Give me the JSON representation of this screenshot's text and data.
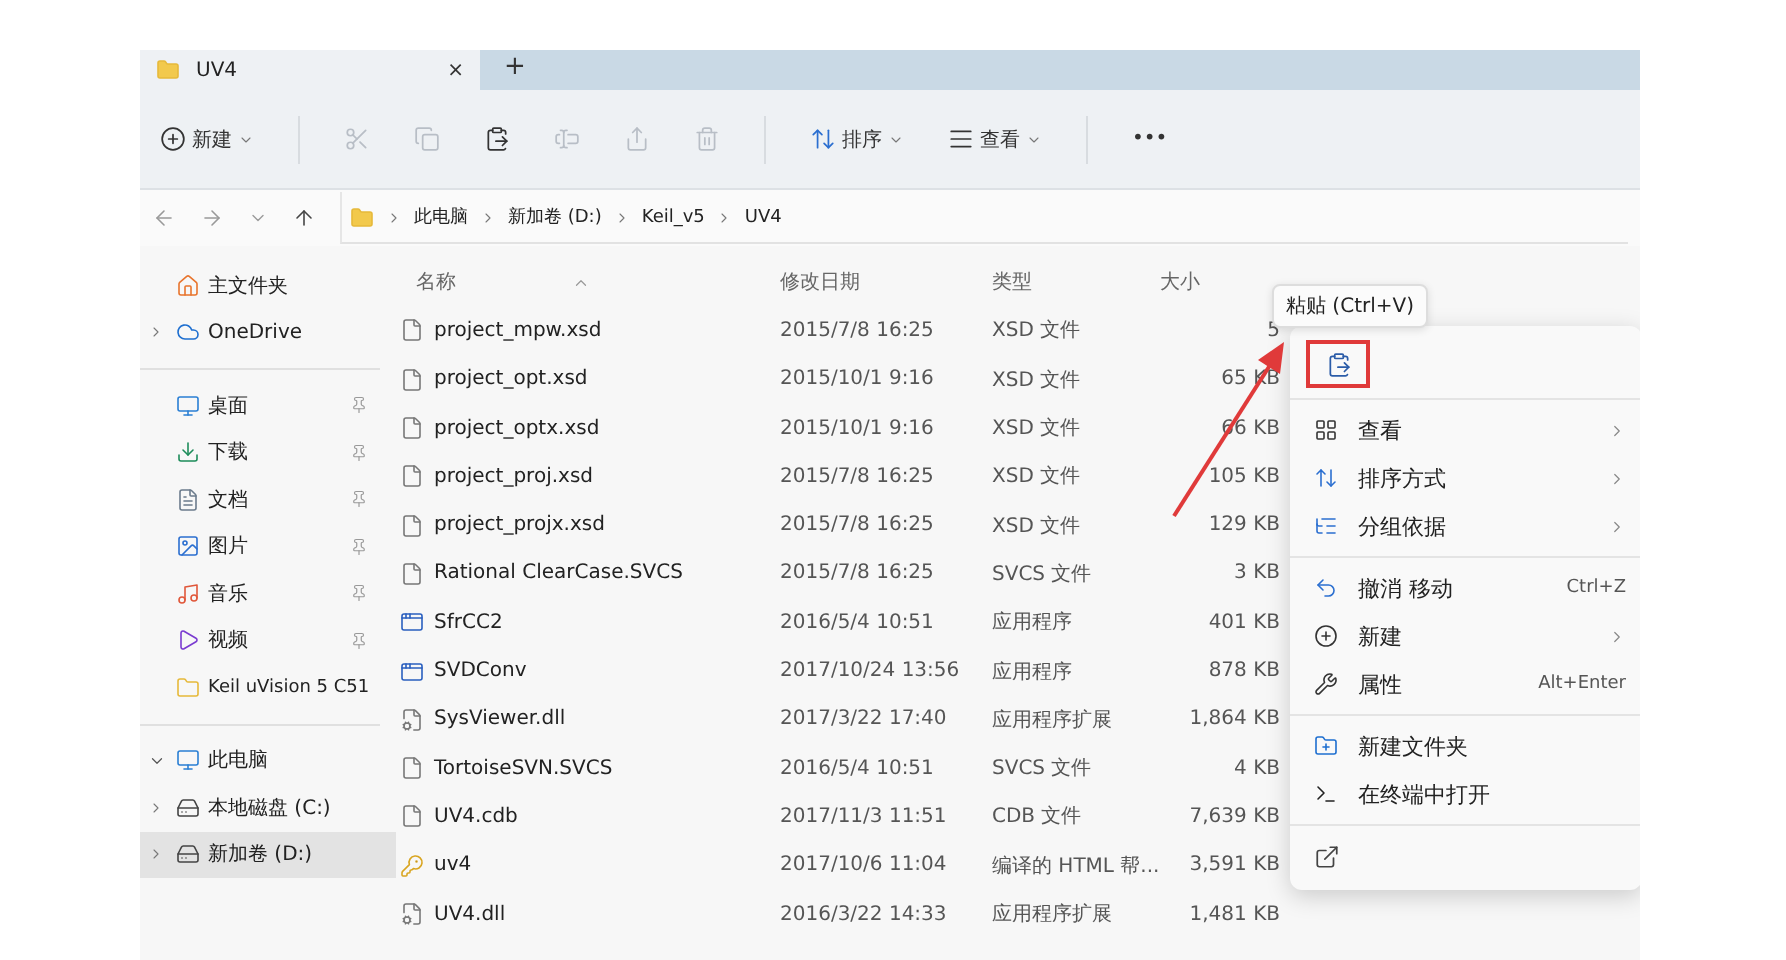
{
  "tab": {
    "title": "UV4",
    "close": "×",
    "new_tab": "+"
  },
  "toolbar": [
    {
      "kind": "new",
      "label": "新建",
      "dropdown": true,
      "disabled": false
    },
    {
      "kind": "cut",
      "disabled": true
    },
    {
      "kind": "copy",
      "disabled": true
    },
    {
      "kind": "paste",
      "disabled": false
    },
    {
      "kind": "rename",
      "disabled": true
    },
    {
      "kind": "share",
      "disabled": true
    },
    {
      "kind": "delete",
      "disabled": true
    },
    {
      "kind": "sort",
      "label": "排序",
      "dropdown": true,
      "disabled": false
    },
    {
      "kind": "view",
      "label": "查看",
      "dropdown": true,
      "disabled": false
    },
    {
      "kind": "more",
      "label": "•••",
      "disabled": false
    }
  ],
  "breadcrumb": [
    "此电脑",
    "新加卷 (D:)",
    "Keil_v5",
    "UV4"
  ],
  "sidebar": [
    [
      {
        "kind": "home",
        "label": "主文件夹",
        "pinned": false,
        "selected": false
      },
      {
        "kind": "cloud",
        "label": "OneDrive",
        "expanded": false,
        "pinned": false,
        "selected": false
      }
    ],
    [
      {
        "kind": "desktop",
        "label": "桌面",
        "pinned": true,
        "selected": false
      },
      {
        "kind": "download",
        "label": "下载",
        "pinned": true,
        "selected": false
      },
      {
        "kind": "document",
        "label": "文档",
        "pinned": true,
        "selected": false
      },
      {
        "kind": "image",
        "label": "图片",
        "pinned": true,
        "selected": false
      },
      {
        "kind": "music",
        "label": "音乐",
        "pinned": true,
        "selected": false
      },
      {
        "kind": "video",
        "label": "视频",
        "pinned": true,
        "selected": false
      },
      {
        "kind": "folder",
        "label": "Keil uVision 5 C51",
        "pinned": false,
        "selected": false
      }
    ],
    [
      {
        "kind": "pc",
        "label": "此电脑",
        "expanded": true,
        "pinned": false,
        "selected": false
      },
      {
        "kind": "drive-c",
        "label": "本地磁盘 (C:)",
        "expanded": false,
        "pinned": false,
        "selected": false
      },
      {
        "kind": "drive",
        "label": "新加卷 (D:)",
        "expanded": false,
        "pinned": false,
        "selected": true
      }
    ]
  ],
  "columns": [
    "名称",
    "修改日期",
    "类型",
    "大小"
  ],
  "rows": [
    {
      "kind": "file",
      "name": "project_mpw.xsd",
      "date": "2015/7/8 16:25",
      "type": "XSD 文件",
      "size": "5"
    },
    {
      "kind": "file",
      "name": "project_opt.xsd",
      "date": "2015/10/1 9:16",
      "type": "XSD 文件",
      "size": "65 KB"
    },
    {
      "kind": "file",
      "name": "project_optx.xsd",
      "date": "2015/10/1 9:16",
      "type": "XSD 文件",
      "size": "66 KB"
    },
    {
      "kind": "file",
      "name": "project_proj.xsd",
      "date": "2015/7/8 16:25",
      "type": "XSD 文件",
      "size": "105 KB"
    },
    {
      "kind": "file",
      "name": "project_projx.xsd",
      "date": "2015/7/8 16:25",
      "type": "XSD 文件",
      "size": "129 KB"
    },
    {
      "kind": "file",
      "name": "Rational ClearCase.SVCS",
      "date": "2015/7/8 16:25",
      "type": "SVCS 文件",
      "size": "3 KB"
    },
    {
      "kind": "app",
      "name": "SfrCC2",
      "date": "2016/5/4 10:51",
      "type": "应用程序",
      "size": "401 KB"
    },
    {
      "kind": "app",
      "name": "SVDConv",
      "date": "2017/10/24 13:56",
      "type": "应用程序",
      "size": "878 KB"
    },
    {
      "kind": "dll",
      "name": "SysViewer.dll",
      "date": "2017/3/22 17:40",
      "type": "应用程序扩展",
      "size": "1,864 KB"
    },
    {
      "kind": "file",
      "name": "TortoiseSVN.SVCS",
      "date": "2016/5/4 10:51",
      "type": "SVCS 文件",
      "size": "4 KB"
    },
    {
      "kind": "file",
      "name": "UV4.cdb",
      "date": "2017/11/3 11:51",
      "type": "CDB 文件",
      "size": "7,639 KB"
    },
    {
      "kind": "key",
      "name": "uv4",
      "date": "2017/10/6 11:04",
      "type": "编译的 HTML 帮...",
      "size": "3,591 KB"
    },
    {
      "kind": "dll",
      "name": "UV4.dll",
      "date": "2016/3/22 14:33",
      "type": "应用程序扩展",
      "size": "1,481 KB"
    }
  ],
  "tooltip": "粘贴 (Ctrl+V)",
  "context_menu": [
    [
      {
        "kind": "paste",
        "highlighted": true
      }
    ],
    [
      {
        "kind": "grid",
        "label": "查看",
        "submenu": true
      },
      {
        "kind": "sort",
        "label": "排序方式",
        "submenu": true
      },
      {
        "kind": "group",
        "label": "分组依据",
        "submenu": true
      }
    ],
    [
      {
        "kind": "undo",
        "label": "撤消 移动",
        "shortcut": "Ctrl+Z",
        "submenu": false
      },
      {
        "kind": "new",
        "label": "新建",
        "submenu": true
      },
      {
        "kind": "wrench",
        "label": "属性",
        "shortcut": "Alt+Enter",
        "submenu": false
      }
    ],
    [
      {
        "kind": "folder-new",
        "label": "新建文件夹",
        "submenu": false
      },
      {
        "kind": "terminal",
        "label": "在终端中打开",
        "submenu": false
      }
    ],
    [
      {
        "kind": "more-options"
      }
    ]
  ]
}
